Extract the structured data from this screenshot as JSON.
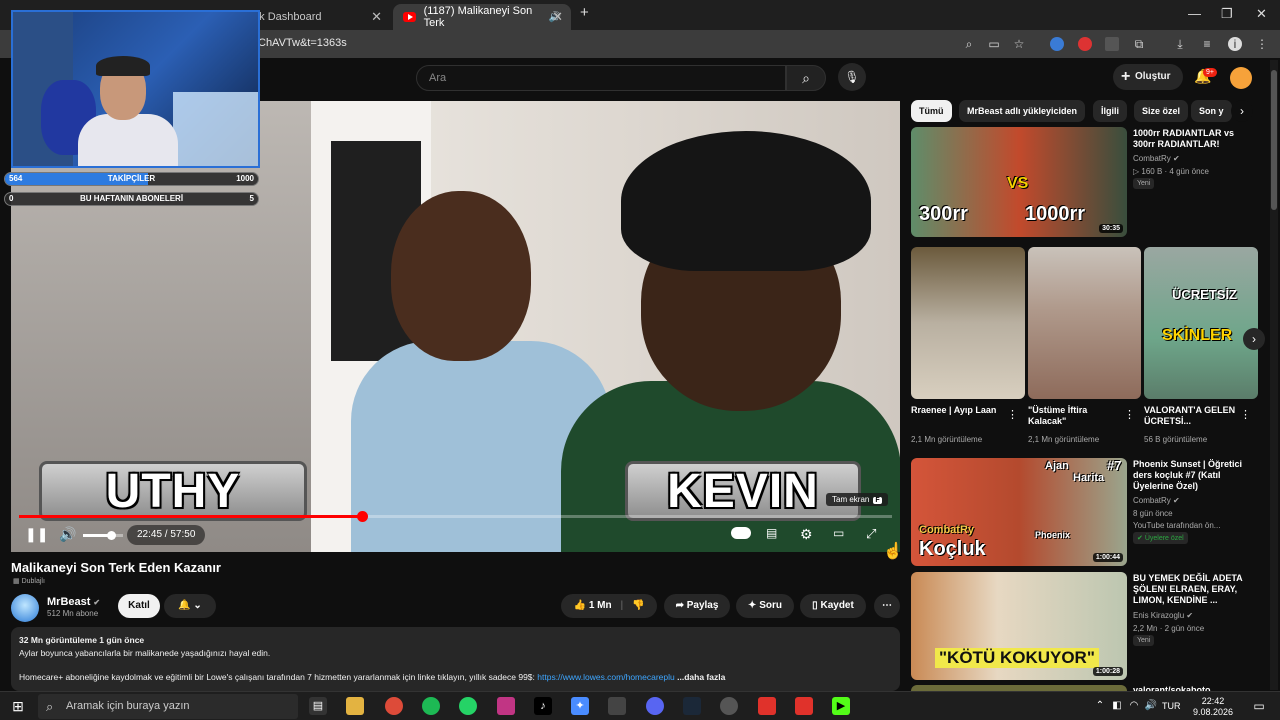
{
  "browser": {
    "tabs": [
      {
        "title": "n - Kick Dashboard",
        "active": false
      },
      {
        "title": "(1187) Malikaneyi Son Terk",
        "active": true
      }
    ],
    "url": "ChAVTw&t=1363s"
  },
  "youtube_header": {
    "search_placeholder": "Ara",
    "create_label": "Oluştur",
    "notification_count": "9+"
  },
  "stream_overlay": {
    "followers": {
      "current": "564",
      "label": "TAKİPÇİLER",
      "goal": "1000",
      "progress": 0.564
    },
    "subs": {
      "current": "0",
      "label": "BU HAFTANIN ABONELERİ",
      "goal": "5",
      "progress": 0.0
    }
  },
  "player": {
    "caption_left": "UTHY",
    "caption_right": "KEVIN",
    "time": "22:45 / 57:50",
    "progress": 0.393,
    "volume": 0.7,
    "fullscreen_tooltip": "Tam ekran",
    "fullscreen_key": "F"
  },
  "video": {
    "title": "Malikaneyi Son Terk Eden Kazanır",
    "dubbed_label": "Dublajlı",
    "channel": "MrBeast",
    "subscribers": "512 Mn abone",
    "join_label": "Katıl",
    "likes": "1 Mn",
    "share_label": "Paylaş",
    "ask_label": "Soru",
    "save_label": "Kaydet",
    "description": {
      "meta": "32 Mn görüntüleme  1 gün önce",
      "line1": "Aylar boyunca yabancılarla bir malikanede yaşadığınızı hayal edin.",
      "line2": "Homecare+ aboneliğine kaydolmak ve eğitimli bir Lowe's çalışanı tarafından 7 hizmetten yararlanmak için linke tıklayın, yıllık sadece 99$: ",
      "link": "https://www.lowes.com/homecareplu",
      "more": "...daha fazla"
    }
  },
  "sidebar": {
    "chips": [
      "Tümü",
      "MrBeast adlı yükleyiciden",
      "İlgili",
      "Size özel",
      "Son y"
    ],
    "top_item": {
      "title": "1000rr RADIANTLAR vs 300rr RADIANTLAR!",
      "channel": "CombatRy",
      "views": "160 B",
      "age": "4 gün önce",
      "badge": "Yeni",
      "duration": "30:35",
      "thumb_left": "300rr",
      "thumb_right": "1000rr",
      "thumb_vs": "VS"
    },
    "shorts": [
      {
        "title": "Rraenee | Ayıp Laan",
        "views": "2,1 Mn görüntüleme"
      },
      {
        "title": "\"Üstüme İftira Kalacak\"",
        "views": "2,1 Mn görüntüleme"
      },
      {
        "title": "VALORANT'A GELEN ÜCRETSİ...",
        "views": "56 B görüntüleme",
        "thumb_text1": "ÜCRETSİZ",
        "thumb_text2": "SKİNLER"
      }
    ],
    "items": [
      {
        "title": "Phoenix Sunset | Öğretici ders koçluk #7 (Katıl Üyelerine Özel)",
        "channel": "CombatRy",
        "age": "8 gün önce",
        "extra": "YouTube tarafından ön...",
        "badge": "Üyelere özel",
        "duration": "1:00:44",
        "thumb_text": "Koçluk",
        "thumb_sub": "CombatRy",
        "thumb_tag": "#7",
        "thumb_label1": "Ajan",
        "thumb_label2": "Harita",
        "thumb_label3": "Phoenix"
      },
      {
        "title": "BU YEMEK DEĞİL ADETA ŞÖLEN! ELRAEN, ERAY, LIMON, KENDİNE ...",
        "channel": "Enis Kirazoglu",
        "views": "2,2 Mn",
        "age": "2 gün önce",
        "badge": "Yeni",
        "duration": "1:00:28",
        "thumb_text": "\"KÖTÜ KOKUYOR\""
      }
    ],
    "next_partial_title": "valorant/sokaboto"
  },
  "taskbar": {
    "search_placeholder": "Aramak için buraya yazın",
    "lang": "TUR",
    "time": "22:42",
    "date": "9.08.2026"
  },
  "colors": {
    "accent_red": "#ff0000",
    "link_blue": "#3ea6ff",
    "overlay_blue": "#2d7be0"
  }
}
